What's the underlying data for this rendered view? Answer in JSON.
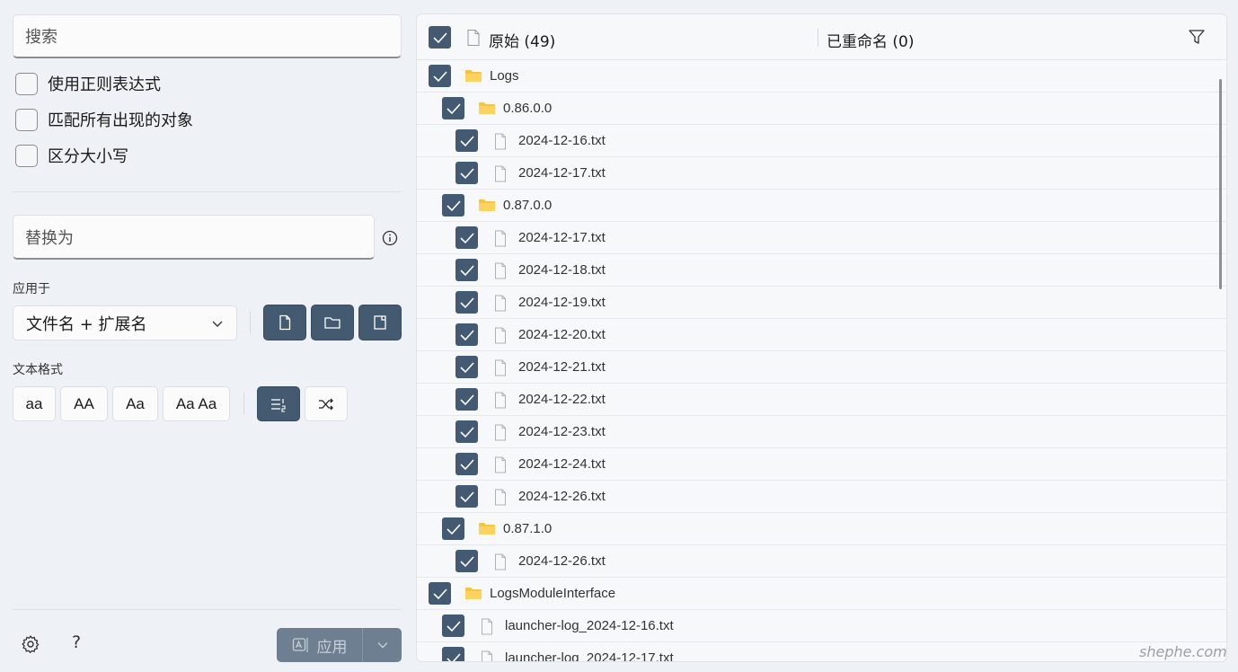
{
  "search": {
    "placeholder": "搜索"
  },
  "options": [
    {
      "label": "使用正则表达式",
      "checked": false
    },
    {
      "label": "匹配所有出现的对象",
      "checked": false
    },
    {
      "label": "区分大小写",
      "checked": false
    }
  ],
  "replace": {
    "placeholder": "替换为"
  },
  "apply_to": {
    "label": "应用于",
    "selected": "文件名 + 扩展名"
  },
  "text_format": {
    "label": "文本格式",
    "buttons": [
      "aa",
      "AA",
      "Aa",
      "Aa Aa"
    ]
  },
  "bottom": {
    "help": "?",
    "apply_label": "应用"
  },
  "header": {
    "original": "原始 (49)",
    "renamed": "已重命名 (0)"
  },
  "tree": [
    {
      "name": "Logs",
      "type": "folder",
      "level": 0
    },
    {
      "name": "0.86.0.0",
      "type": "folder",
      "level": 1
    },
    {
      "name": "2024-12-16.txt",
      "type": "file",
      "level": 2
    },
    {
      "name": "2024-12-17.txt",
      "type": "file",
      "level": 2
    },
    {
      "name": "0.87.0.0",
      "type": "folder",
      "level": 1
    },
    {
      "name": "2024-12-17.txt",
      "type": "file",
      "level": 2
    },
    {
      "name": "2024-12-18.txt",
      "type": "file",
      "level": 2
    },
    {
      "name": "2024-12-19.txt",
      "type": "file",
      "level": 2
    },
    {
      "name": "2024-12-20.txt",
      "type": "file",
      "level": 2
    },
    {
      "name": "2024-12-21.txt",
      "type": "file",
      "level": 2
    },
    {
      "name": "2024-12-22.txt",
      "type": "file",
      "level": 2
    },
    {
      "name": "2024-12-23.txt",
      "type": "file",
      "level": 2
    },
    {
      "name": "2024-12-24.txt",
      "type": "file",
      "level": 2
    },
    {
      "name": "2024-12-26.txt",
      "type": "file",
      "level": 2
    },
    {
      "name": "0.87.1.0",
      "type": "folder",
      "level": 1
    },
    {
      "name": "2024-12-26.txt",
      "type": "file",
      "level": 2
    },
    {
      "name": "LogsModuleInterface",
      "type": "folder",
      "level": 0
    },
    {
      "name": "launcher-log_2024-12-16.txt",
      "type": "file",
      "level": 1
    },
    {
      "name": "launcher-log_2024-12-17.txt",
      "type": "file",
      "level": 1
    }
  ],
  "watermark": "shephe.com",
  "colors": {
    "accent": "#435a72",
    "folder": "#f5c542"
  }
}
